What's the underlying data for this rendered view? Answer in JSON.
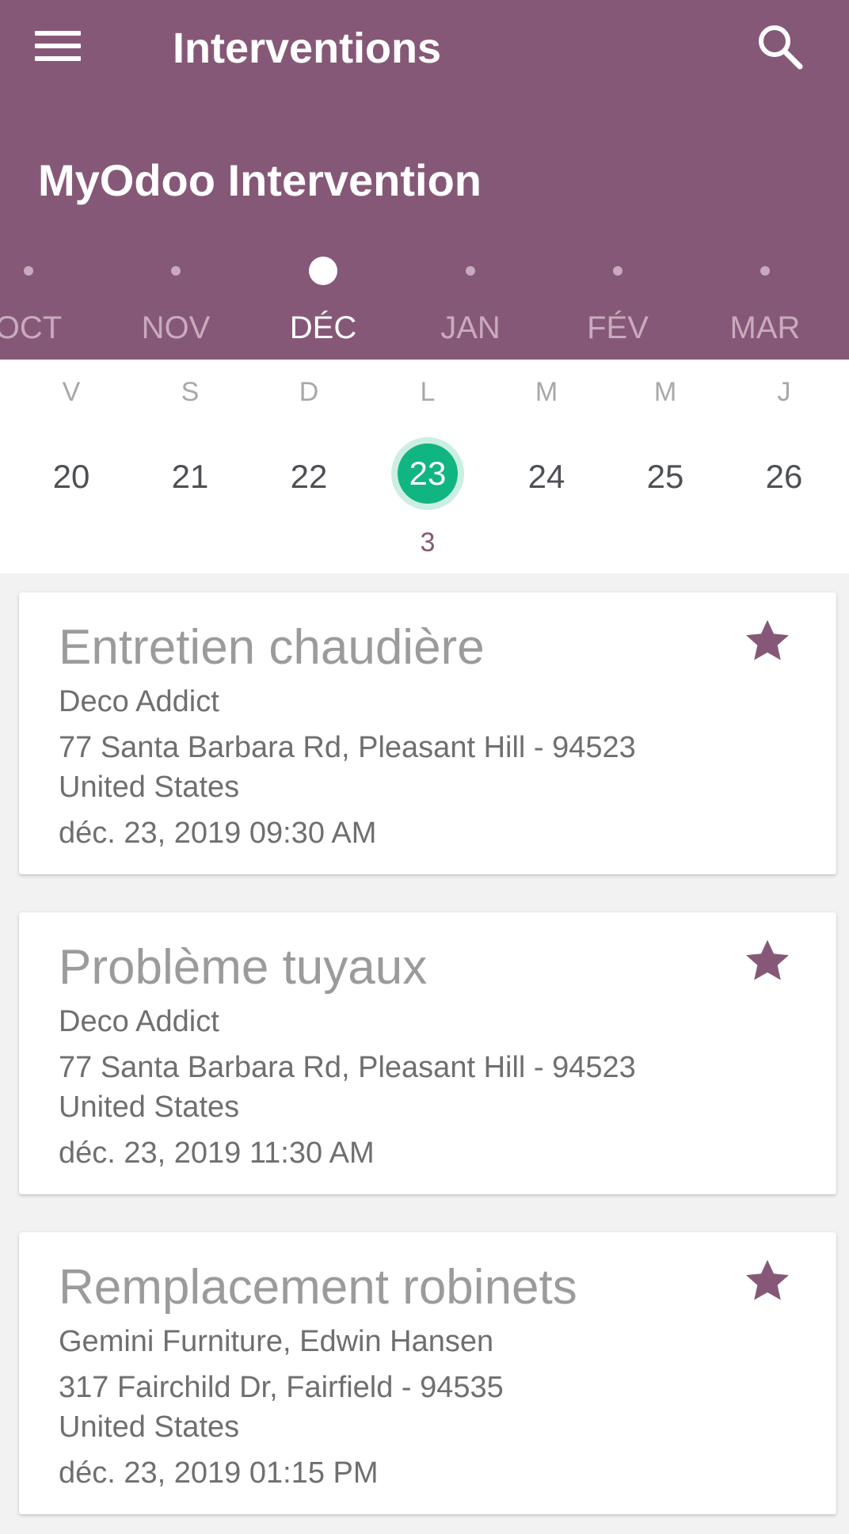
{
  "toolbar": {
    "title": "Interventions",
    "menu_icon": "hamburger-menu-icon",
    "search_icon": "search-icon"
  },
  "header": {
    "app_name": "MyOdoo Intervention"
  },
  "months": [
    {
      "label": "OCT",
      "active": false
    },
    {
      "label": "NOV",
      "active": false
    },
    {
      "label": "DÉC",
      "active": true
    },
    {
      "label": "JAN",
      "active": false
    },
    {
      "label": "FÉV",
      "active": false
    },
    {
      "label": "MAR",
      "active": false
    }
  ],
  "week": {
    "weekdays": [
      "V",
      "S",
      "D",
      "L",
      "M",
      "M",
      "J"
    ],
    "days": [
      "20",
      "21",
      "22",
      "23",
      "24",
      "25",
      "26"
    ],
    "selected_day": "23",
    "selected_day_event_count": "3"
  },
  "interventions": [
    {
      "title": "Entretien chaudière",
      "customer": "Deco Addict",
      "address": "77 Santa Barbara Rd, Pleasant Hill - 94523",
      "country": "United States",
      "datetime": "déc. 23, 2019 09:30 AM",
      "icon": "star-icon"
    },
    {
      "title": "Problème tuyaux",
      "customer": "Deco Addict",
      "address": "77 Santa Barbara Rd, Pleasant Hill - 94523",
      "country": "United States",
      "datetime": "déc. 23, 2019 11:30 AM",
      "icon": "star-icon"
    },
    {
      "title": "Remplacement robinets",
      "customer": "Gemini Furniture, Edwin Hansen",
      "address": "317 Fairchild Dr, Fairfield - 94535",
      "country": "United States",
      "datetime": "déc. 23, 2019 01:15 PM",
      "icon": "star-icon"
    }
  ],
  "colors": {
    "primary": "#865877",
    "selected_day": "#11b581",
    "selected_day_halo": "#cdeee3",
    "star": "#865877",
    "background": "#f2f2f2"
  }
}
